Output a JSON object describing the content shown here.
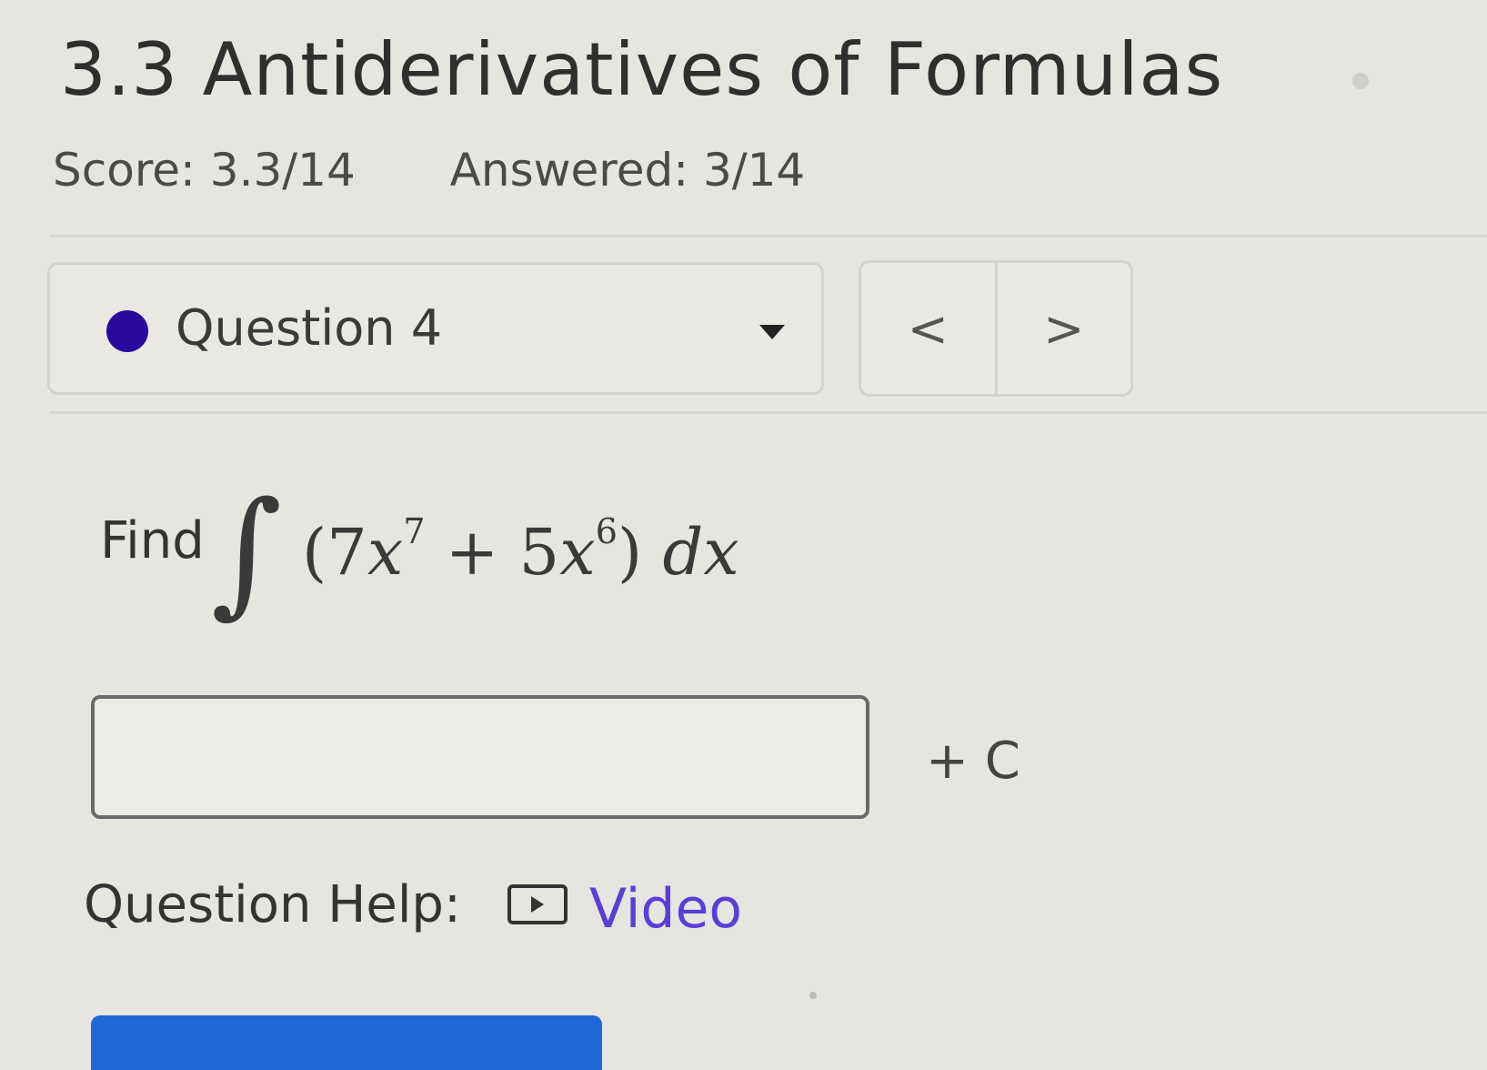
{
  "header": {
    "title": "3.3 Antiderivatives of Formulas",
    "score": "Score: 3.3/14",
    "answered": "Answered: 3/14"
  },
  "question_nav": {
    "selected": "Question 4",
    "prev_label": "<",
    "next_label": ">"
  },
  "question": {
    "prompt": "Find",
    "integral_symbol": "∫",
    "integrand_open": "(7",
    "var1": "x",
    "exp1": "7",
    "plus": " + 5",
    "var2": "x",
    "exp2": "6",
    "integrand_close": ") ",
    "differential": "dx",
    "constant_suffix": "+ C"
  },
  "answer": {
    "value": ""
  },
  "help": {
    "label": "Question Help:",
    "video_label": "Video"
  },
  "colors": {
    "question_dot": "#2a0a9e",
    "link": "#5a3fd6",
    "submit_button": "#1f66d6"
  }
}
